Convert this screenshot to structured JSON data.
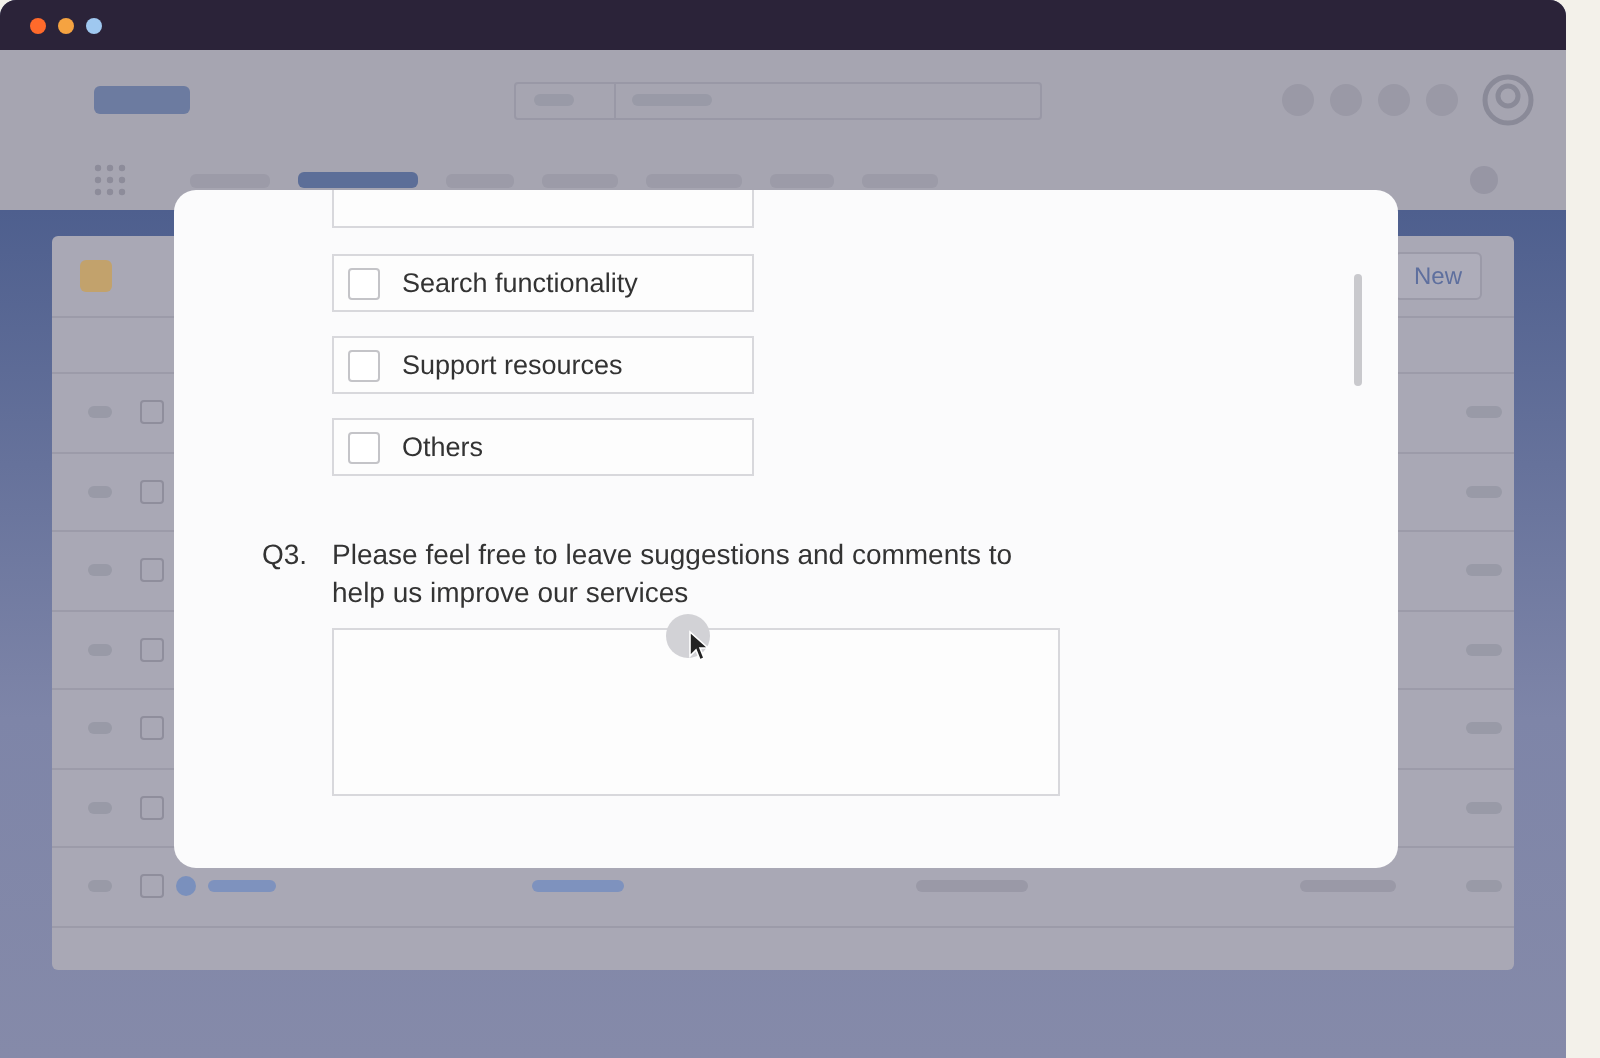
{
  "background_app": {
    "nav_tabs": [
      {
        "selected": false
      },
      {
        "selected": true
      },
      {
        "selected": false
      },
      {
        "selected": false
      },
      {
        "selected": false
      },
      {
        "selected": false
      },
      {
        "selected": false
      }
    ],
    "new_button": "New",
    "rows": [
      {
        "checked": false
      },
      {
        "checked": false
      },
      {
        "checked": false
      },
      {
        "checked": false
      },
      {
        "checked": false
      },
      {
        "checked": false
      },
      {
        "checked": false
      }
    ]
  },
  "dialog": {
    "options": [
      {
        "label": "Search functionality",
        "checked": false
      },
      {
        "label": "Support resources",
        "checked": false
      },
      {
        "label": "Others",
        "checked": false
      }
    ],
    "question": {
      "number": "Q3.",
      "text": "Please feel free to leave suggestions and comments to help us improve our services"
    }
  }
}
